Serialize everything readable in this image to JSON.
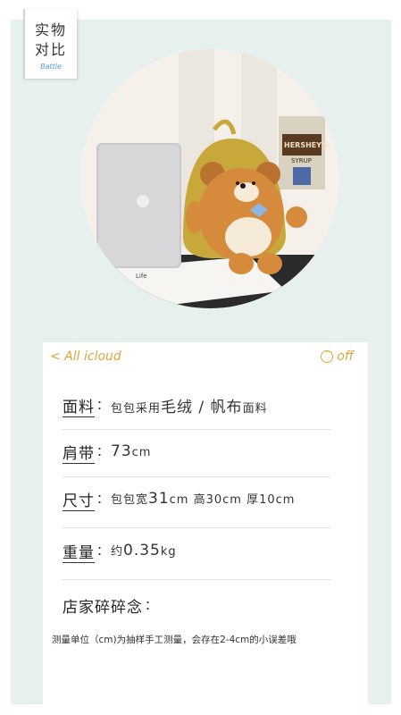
{
  "tag": {
    "line1": "实物",
    "line2": "对比",
    "en": "Battle"
  },
  "photo": {
    "laptop_label": "Life",
    "poster_text": "HERSHEY'S SYRUP",
    "colors": {
      "backpack": "#c8a83a",
      "bear": "#d58a3c",
      "bow": "#8fb5e0"
    }
  },
  "card": {
    "back_label": "< All icloud",
    "right_label": "off",
    "rows": [
      {
        "label": "面料",
        "colon": "：",
        "value_pre": "包包采用",
        "value_mid": "毛绒 / 帆布",
        "value_post": "面料"
      },
      {
        "label": "肩带",
        "colon": "：",
        "value_pre": "",
        "value_mid": "73",
        "value_post": "cm"
      },
      {
        "label": "尺寸",
        "colon": "：",
        "value_pre": "包包宽",
        "value_mid": "31",
        "value_post": "cm  高30cm  厚10cm"
      },
      {
        "label": "重量",
        "colon": "：",
        "value_pre": "约",
        "value_mid": "0.35",
        "value_post": "kg"
      },
      {
        "label": "店家碎碎念",
        "colon": "：",
        "value_pre": "",
        "value_mid": "",
        "value_post": ""
      }
    ],
    "note": "测量单位（cm)为抽样手工测量，会存在2-4cm的小误差哦"
  },
  "accent": "#e0a43a",
  "background": "#e6f0ed"
}
